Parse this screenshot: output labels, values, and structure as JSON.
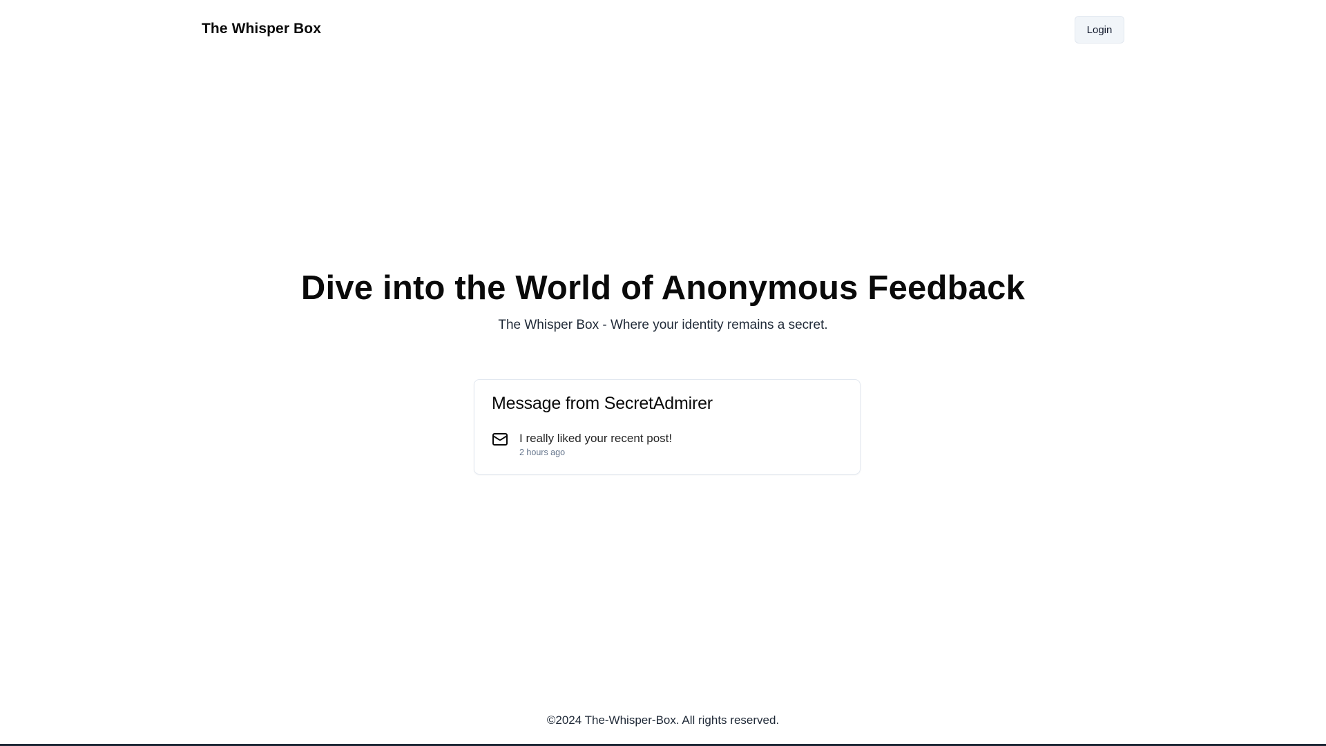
{
  "header": {
    "brand": "The Whisper Box",
    "login_label": "Login"
  },
  "hero": {
    "title": "Dive into the World of Anonymous Feedback",
    "subtitle": "The Whisper Box - Where your identity remains a secret."
  },
  "message_card": {
    "title": "Message from SecretAdmirer",
    "icon": "mail-icon",
    "content": "I really liked your recent post!",
    "received": "2 hours ago"
  },
  "footer": {
    "text": "©2024 The-Whisper-Box. All rights reserved."
  },
  "colors": {
    "text": "#0a0a0a",
    "muted": "#64748b",
    "border": "#e2e8f0",
    "button_bg": "#f1f5f9"
  }
}
